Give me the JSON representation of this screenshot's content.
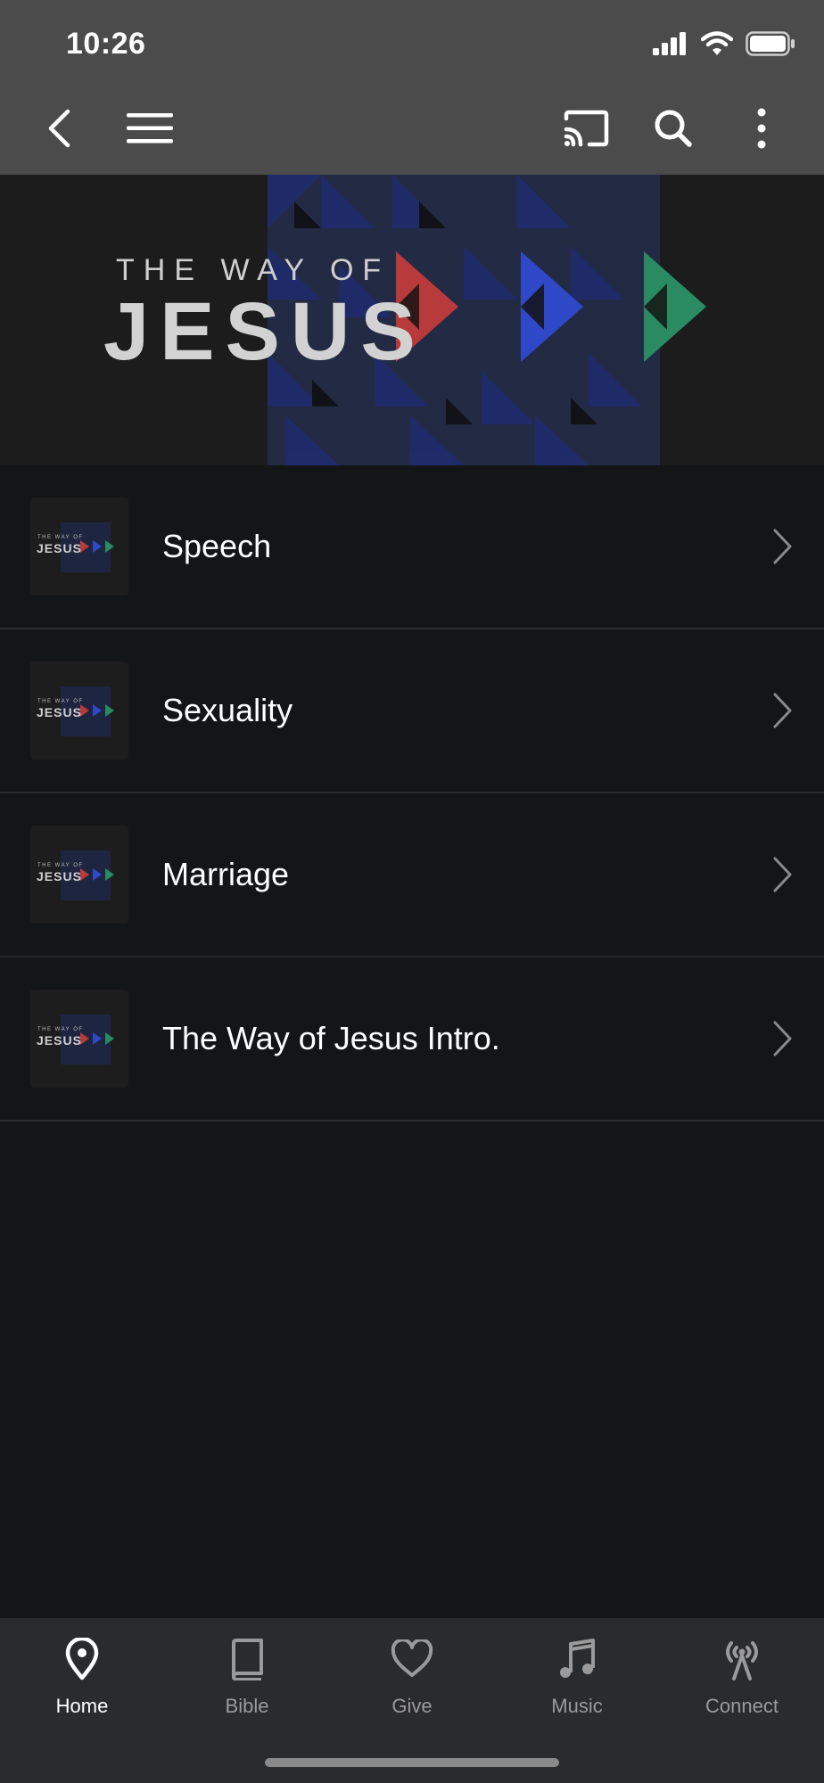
{
  "status_bar": {
    "time": "10:26"
  },
  "hero": {
    "kicker": "THE WAY OF",
    "title": "JESUS"
  },
  "thumbnail": {
    "kicker": "THE WAY OF",
    "title": "JESUS"
  },
  "list": {
    "items": [
      {
        "label": "Speech"
      },
      {
        "label": "Sexuality"
      },
      {
        "label": "Marriage"
      },
      {
        "label": "The Way of Jesus Intro."
      }
    ]
  },
  "tabbar": {
    "tabs": [
      {
        "label": "Home",
        "icon": "map-pin-icon",
        "active": true
      },
      {
        "label": "Bible",
        "icon": "book-icon",
        "active": false
      },
      {
        "label": "Give",
        "icon": "heart-icon",
        "active": false
      },
      {
        "label": "Music",
        "icon": "music-note-icon",
        "active": false
      },
      {
        "label": "Connect",
        "icon": "broadcast-tower-icon",
        "active": false
      }
    ]
  },
  "colors": {
    "header_bg": "#4b4b4b",
    "page_bg": "#141517",
    "accent_red": "#b83a3a",
    "accent_blue": "#2f48c8",
    "accent_green": "#2a8a62"
  }
}
